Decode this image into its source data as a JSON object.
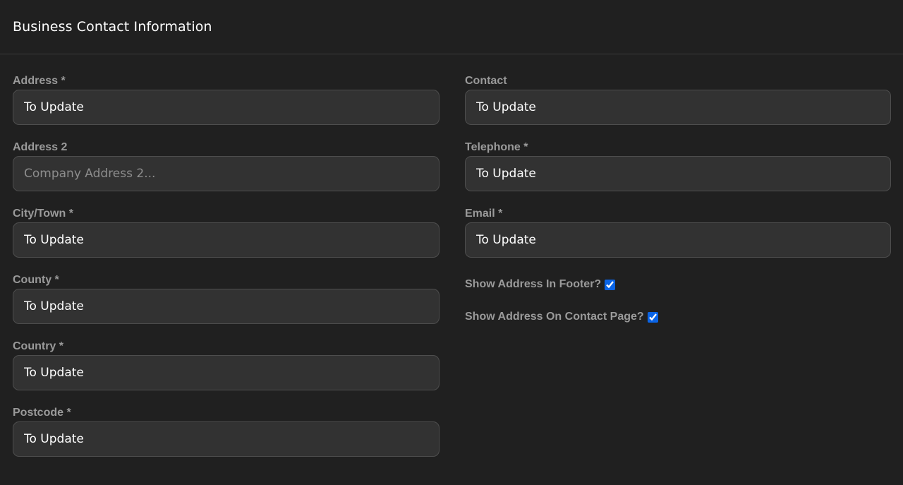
{
  "header": {
    "title": "Business Contact Information"
  },
  "left_fields": [
    {
      "label": "Address *",
      "value": "To Update",
      "placeholder": ""
    },
    {
      "label": "Address 2",
      "value": "",
      "placeholder": "Company Address 2..."
    },
    {
      "label": "City/Town *",
      "value": "To Update",
      "placeholder": ""
    },
    {
      "label": "County *",
      "value": "To Update",
      "placeholder": ""
    },
    {
      "label": "Country *",
      "value": "To Update",
      "placeholder": ""
    },
    {
      "label": "Postcode *",
      "value": "To Update",
      "placeholder": ""
    }
  ],
  "right_fields": [
    {
      "label": "Contact",
      "value": "To Update",
      "placeholder": ""
    },
    {
      "label": "Telephone *",
      "value": "To Update",
      "placeholder": ""
    },
    {
      "label": "Email *",
      "value": "To Update",
      "placeholder": ""
    }
  ],
  "checkboxes": [
    {
      "label": "Show Address In Footer?",
      "checked": true
    },
    {
      "label": "Show Address On Contact Page?",
      "checked": true
    }
  ],
  "colors": {
    "background": "#202020",
    "input_background": "#323232",
    "label": "#9a9a9a",
    "checkbox_accent": "#0a64e6"
  }
}
